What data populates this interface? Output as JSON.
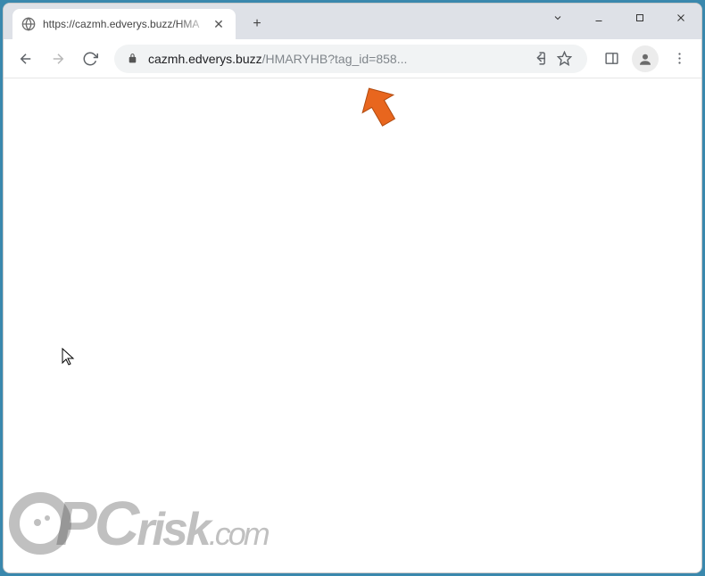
{
  "tab": {
    "title": "https://cazmh.edverys.buzz/HMA"
  },
  "address": {
    "domain": "cazmh.edverys.buzz",
    "path": "/HMARYHB?tag_id=858..."
  },
  "watermark": {
    "pc": "PC",
    "risk": "risk",
    "com": ".com"
  }
}
